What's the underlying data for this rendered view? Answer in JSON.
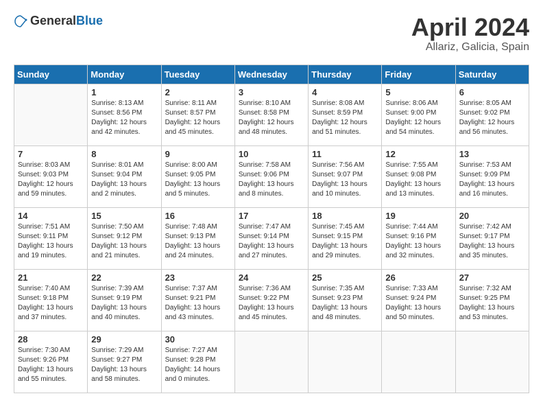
{
  "header": {
    "logo": {
      "general": "General",
      "blue": "Blue"
    },
    "title": "April 2024",
    "location": "Allariz, Galicia, Spain"
  },
  "days_of_week": [
    "Sunday",
    "Monday",
    "Tuesday",
    "Wednesday",
    "Thursday",
    "Friday",
    "Saturday"
  ],
  "weeks": [
    [
      {
        "day": "",
        "info": ""
      },
      {
        "day": "1",
        "info": "Sunrise: 8:13 AM\nSunset: 8:56 PM\nDaylight: 12 hours\nand 42 minutes."
      },
      {
        "day": "2",
        "info": "Sunrise: 8:11 AM\nSunset: 8:57 PM\nDaylight: 12 hours\nand 45 minutes."
      },
      {
        "day": "3",
        "info": "Sunrise: 8:10 AM\nSunset: 8:58 PM\nDaylight: 12 hours\nand 48 minutes."
      },
      {
        "day": "4",
        "info": "Sunrise: 8:08 AM\nSunset: 8:59 PM\nDaylight: 12 hours\nand 51 minutes."
      },
      {
        "day": "5",
        "info": "Sunrise: 8:06 AM\nSunset: 9:00 PM\nDaylight: 12 hours\nand 54 minutes."
      },
      {
        "day": "6",
        "info": "Sunrise: 8:05 AM\nSunset: 9:02 PM\nDaylight: 12 hours\nand 56 minutes."
      }
    ],
    [
      {
        "day": "7",
        "info": "Sunrise: 8:03 AM\nSunset: 9:03 PM\nDaylight: 12 hours\nand 59 minutes."
      },
      {
        "day": "8",
        "info": "Sunrise: 8:01 AM\nSunset: 9:04 PM\nDaylight: 13 hours\nand 2 minutes."
      },
      {
        "day": "9",
        "info": "Sunrise: 8:00 AM\nSunset: 9:05 PM\nDaylight: 13 hours\nand 5 minutes."
      },
      {
        "day": "10",
        "info": "Sunrise: 7:58 AM\nSunset: 9:06 PM\nDaylight: 13 hours\nand 8 minutes."
      },
      {
        "day": "11",
        "info": "Sunrise: 7:56 AM\nSunset: 9:07 PM\nDaylight: 13 hours\nand 10 minutes."
      },
      {
        "day": "12",
        "info": "Sunrise: 7:55 AM\nSunset: 9:08 PM\nDaylight: 13 hours\nand 13 minutes."
      },
      {
        "day": "13",
        "info": "Sunrise: 7:53 AM\nSunset: 9:09 PM\nDaylight: 13 hours\nand 16 minutes."
      }
    ],
    [
      {
        "day": "14",
        "info": "Sunrise: 7:51 AM\nSunset: 9:11 PM\nDaylight: 13 hours\nand 19 minutes."
      },
      {
        "day": "15",
        "info": "Sunrise: 7:50 AM\nSunset: 9:12 PM\nDaylight: 13 hours\nand 21 minutes."
      },
      {
        "day": "16",
        "info": "Sunrise: 7:48 AM\nSunset: 9:13 PM\nDaylight: 13 hours\nand 24 minutes."
      },
      {
        "day": "17",
        "info": "Sunrise: 7:47 AM\nSunset: 9:14 PM\nDaylight: 13 hours\nand 27 minutes."
      },
      {
        "day": "18",
        "info": "Sunrise: 7:45 AM\nSunset: 9:15 PM\nDaylight: 13 hours\nand 29 minutes."
      },
      {
        "day": "19",
        "info": "Sunrise: 7:44 AM\nSunset: 9:16 PM\nDaylight: 13 hours\nand 32 minutes."
      },
      {
        "day": "20",
        "info": "Sunrise: 7:42 AM\nSunset: 9:17 PM\nDaylight: 13 hours\nand 35 minutes."
      }
    ],
    [
      {
        "day": "21",
        "info": "Sunrise: 7:40 AM\nSunset: 9:18 PM\nDaylight: 13 hours\nand 37 minutes."
      },
      {
        "day": "22",
        "info": "Sunrise: 7:39 AM\nSunset: 9:19 PM\nDaylight: 13 hours\nand 40 minutes."
      },
      {
        "day": "23",
        "info": "Sunrise: 7:37 AM\nSunset: 9:21 PM\nDaylight: 13 hours\nand 43 minutes."
      },
      {
        "day": "24",
        "info": "Sunrise: 7:36 AM\nSunset: 9:22 PM\nDaylight: 13 hours\nand 45 minutes."
      },
      {
        "day": "25",
        "info": "Sunrise: 7:35 AM\nSunset: 9:23 PM\nDaylight: 13 hours\nand 48 minutes."
      },
      {
        "day": "26",
        "info": "Sunrise: 7:33 AM\nSunset: 9:24 PM\nDaylight: 13 hours\nand 50 minutes."
      },
      {
        "day": "27",
        "info": "Sunrise: 7:32 AM\nSunset: 9:25 PM\nDaylight: 13 hours\nand 53 minutes."
      }
    ],
    [
      {
        "day": "28",
        "info": "Sunrise: 7:30 AM\nSunset: 9:26 PM\nDaylight: 13 hours\nand 55 minutes."
      },
      {
        "day": "29",
        "info": "Sunrise: 7:29 AM\nSunset: 9:27 PM\nDaylight: 13 hours\nand 58 minutes."
      },
      {
        "day": "30",
        "info": "Sunrise: 7:27 AM\nSunset: 9:28 PM\nDaylight: 14 hours\nand 0 minutes."
      },
      {
        "day": "",
        "info": ""
      },
      {
        "day": "",
        "info": ""
      },
      {
        "day": "",
        "info": ""
      },
      {
        "day": "",
        "info": ""
      }
    ]
  ]
}
